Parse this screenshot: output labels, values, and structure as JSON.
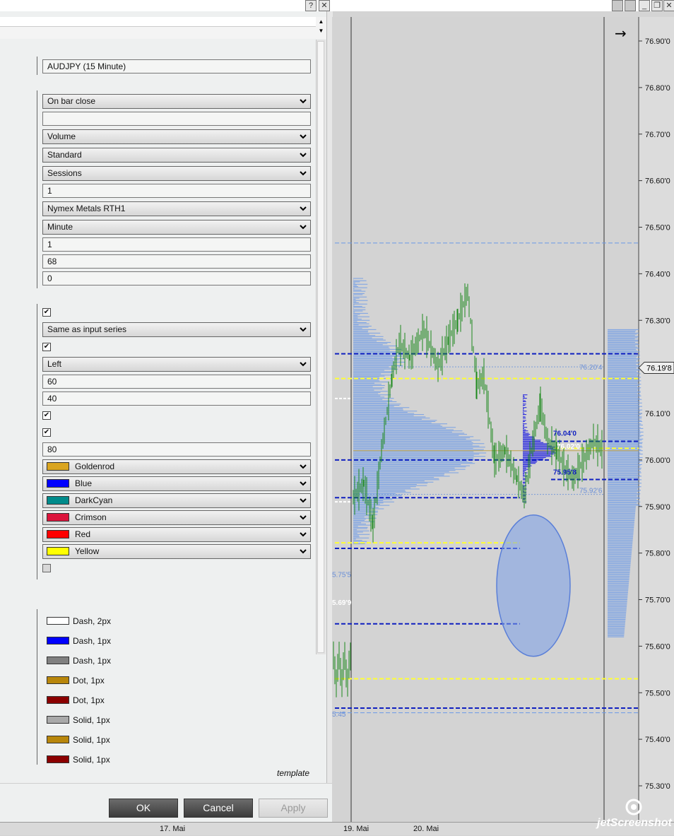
{
  "dialog": {
    "title_buttons": [
      "?",
      "✕"
    ],
    "fields": {
      "instrument": "AUDJPY (15 Minute)",
      "calculate": "On bar close",
      "label": "",
      "volume_type": "Volume",
      "profile_type": "Standard",
      "period": "Sessions",
      "period_count": "1",
      "session_template": "Nymex Metals RTH1",
      "resolution_type": "Minute",
      "resolution_value": "1",
      "value_area_pct": "68",
      "displacement": "0",
      "fill_source": "Same as input series",
      "alignment": "Left",
      "width": "60",
      "opacity": "40",
      "opacity_2": "80"
    },
    "checkboxes": {
      "cb1": true,
      "cb2": true,
      "cb3": true,
      "cb4": true,
      "cb5": false
    },
    "colors": [
      {
        "name": "Goldenrod",
        "hex": "#DAA520"
      },
      {
        "name": "Blue",
        "hex": "#0000FF"
      },
      {
        "name": "DarkCyan",
        "hex": "#008B8B"
      },
      {
        "name": "Crimson",
        "hex": "#DC143C"
      },
      {
        "name": "Red",
        "hex": "#FF0000"
      },
      {
        "name": "Yellow",
        "hex": "#FFFF00"
      }
    ],
    "strokes": [
      {
        "label": "Dash, 2px",
        "hex": "#FFFFFF"
      },
      {
        "label": "Dash, 1px",
        "hex": "#0000FF"
      },
      {
        "label": "Dash, 1px",
        "hex": "#808080"
      },
      {
        "label": "Dot, 1px",
        "hex": "#B8860B"
      },
      {
        "label": "Dot, 1px",
        "hex": "#8B0000"
      },
      {
        "label": "Solid, 1px",
        "hex": "#A9A9A9"
      },
      {
        "label": "Solid, 1px",
        "hex": "#B8860B"
      },
      {
        "label": "Solid, 1px",
        "hex": "#8B0000"
      }
    ],
    "template_label": "template",
    "buttons": {
      "ok": "OK",
      "cancel": "Cancel",
      "apply": "Apply"
    }
  },
  "chart": {
    "price_axis": [
      "76.90'0",
      "76.80'0",
      "76.70'0",
      "76.60'0",
      "76.50'0",
      "76.40'0",
      "76.30'0",
      "76.20'0",
      "76.10'0",
      "76.00'0",
      "75.90'0",
      "75.80'0",
      "75.70'0",
      "75.60'0",
      "75.50'0",
      "75.40'0",
      "75.30'0"
    ],
    "current_price": "76.19'8",
    "labels": {
      "vah": "76.20'4",
      "poc_hi": "76.04'0",
      "poc_mid": "76.02'0",
      "val": "75.95'8",
      "low": "75.92'6",
      "left1": "5.75'5",
      "left2": "5.69'9",
      "left3": "5.45"
    },
    "x_labels": [
      "17. Mai",
      "19. Mai",
      "20. Mai"
    ],
    "nav_arrow": "→",
    "window_buttons": [
      "_",
      "❐",
      "✕"
    ],
    "watermark": "jetScreenshot"
  }
}
